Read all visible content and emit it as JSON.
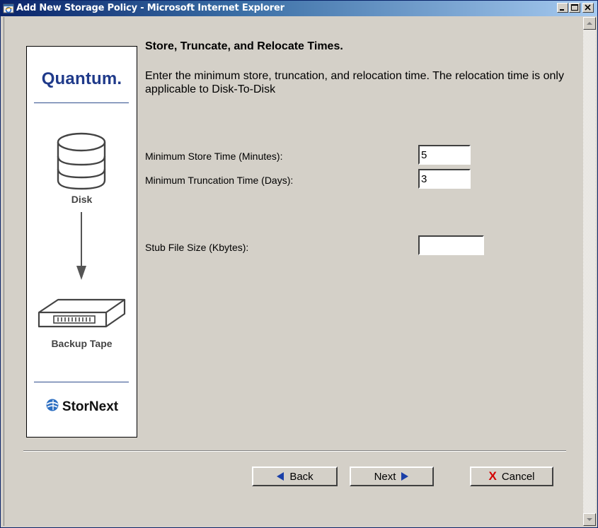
{
  "window": {
    "title": "Add New Storage Policy - Microsoft Internet Explorer"
  },
  "sidebar": {
    "brand": "Quantum.",
    "source_label": "Disk",
    "destination_label": "Backup Tape",
    "product": "StorNext"
  },
  "main": {
    "heading": "Store, Truncate, and Relocate Times.",
    "instructions": "Enter the minimum store, truncation, and relocation time. The relocation time is only applicable to Disk-To-Disk",
    "fields": {
      "min_store": {
        "label": "Minimum Store Time (Minutes):",
        "value": "5"
      },
      "min_truncation": {
        "label": "Minimum Truncation Time (Days):",
        "value": "3"
      },
      "stub_size": {
        "label": "Stub File Size (Kbytes):",
        "value": ""
      }
    }
  },
  "buttons": {
    "back": "Back",
    "next": "Next",
    "cancel": "Cancel"
  },
  "colors": {
    "title_bar": "#0A246A",
    "brand": "#1F3A8A",
    "nav_arrow": "#1A3FA8",
    "cancel_x": "#D40000"
  },
  "icons": {
    "window": "ie-icon",
    "source": "disk-icon",
    "flow": "arrow-down-icon",
    "destination": "tape-icon",
    "product": "stornext-globe-icon"
  }
}
